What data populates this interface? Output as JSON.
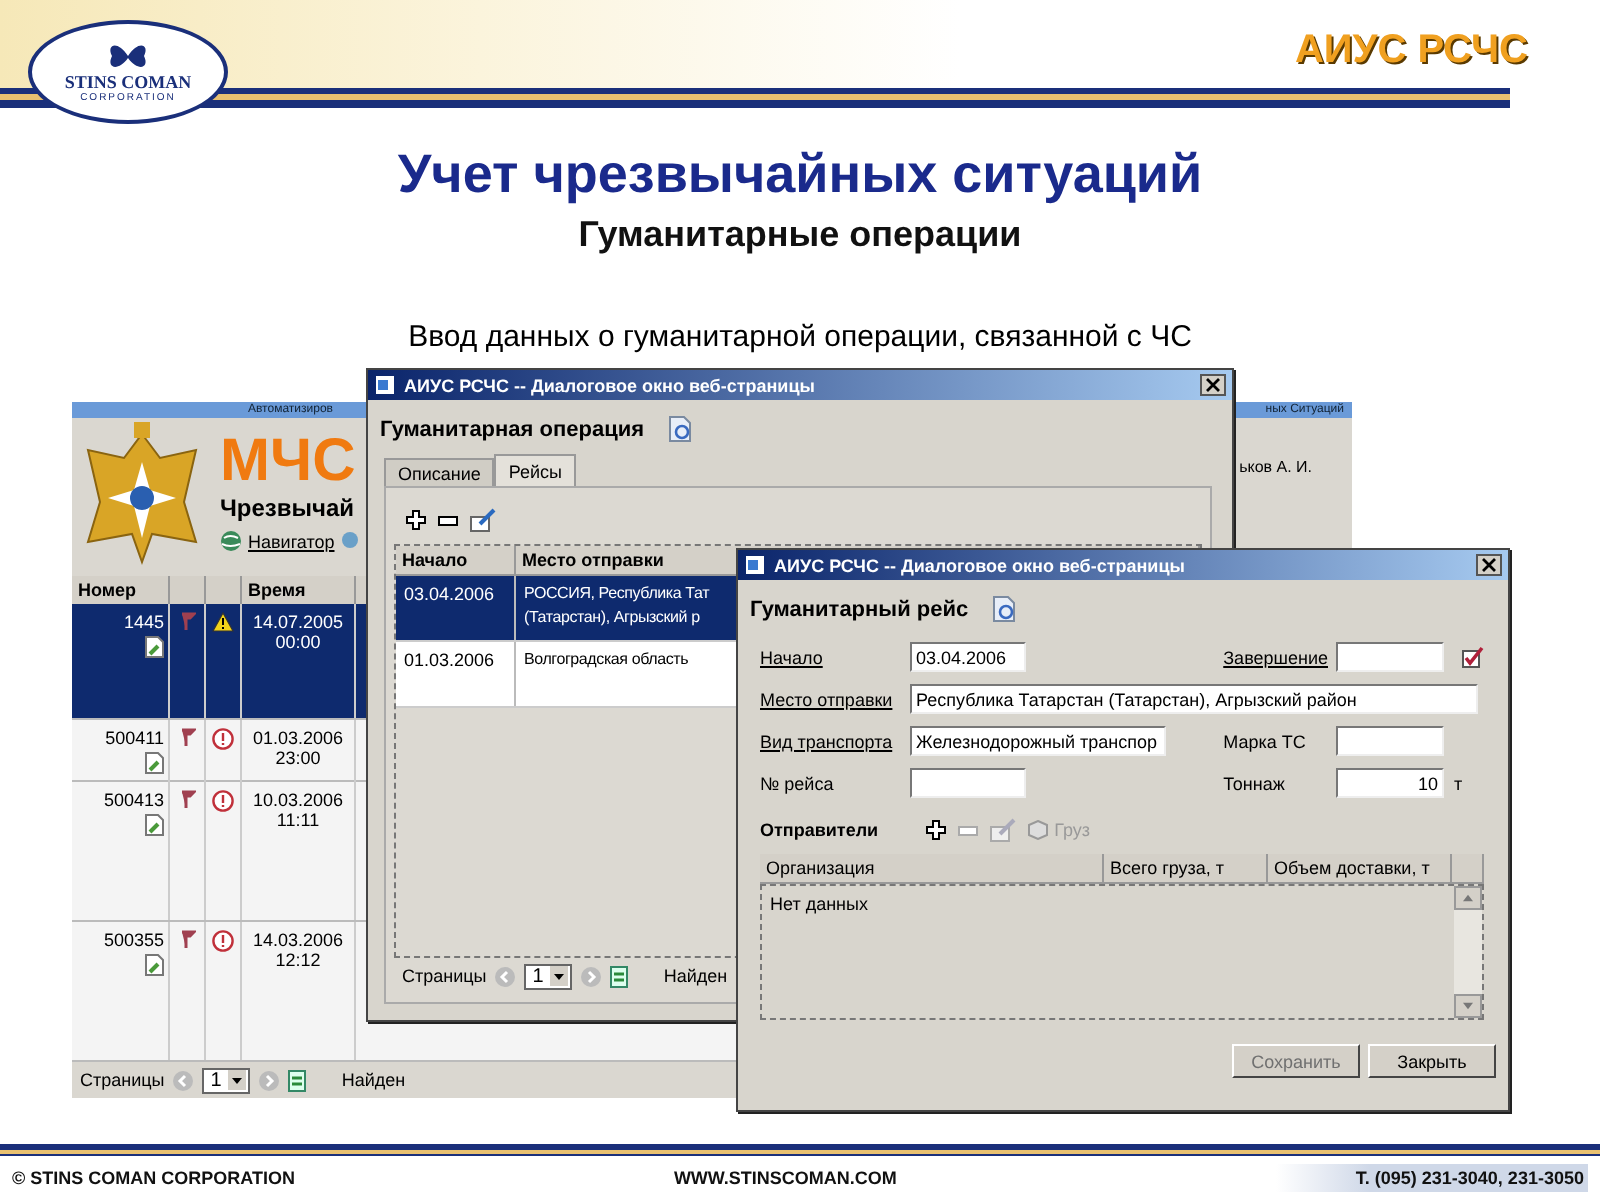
{
  "slide": {
    "brand": "АИУС РСЧС",
    "logo_name": "STINS COMAN",
    "logo_sub": "CORPORATION",
    "title": "Учет чрезвычайных ситуаций",
    "subtitle": "Гуманитарные операции",
    "description": "Ввод данных о гуманитарной операции, связанной с ЧС"
  },
  "background_app": {
    "banner_left": "Автоматизиров",
    "banner_right": "ных Ситуаций",
    "logo_text": "МЧС",
    "heading": "Чрезвычай",
    "nav_link": "Навигатор",
    "user": "ьков А. И.",
    "columns": [
      "Номер",
      "Время"
    ],
    "rows": [
      {
        "number": "1445",
        "date": "14.07.2005",
        "time": "00:00",
        "kind": "warning",
        "selected": true
      },
      {
        "number": "500411",
        "date": "01.03.2006",
        "time": "23:00",
        "kind": "error",
        "selected": false
      },
      {
        "number": "500413",
        "date": "10.03.2006",
        "time": "11:11",
        "kind": "error",
        "selected": false
      },
      {
        "number": "500355",
        "date": "14.03.2006",
        "time": "12:12",
        "kind": "error",
        "selected": false
      }
    ],
    "pager": {
      "label": "Страницы",
      "page": "1",
      "found": "Найден"
    }
  },
  "operation_dialog": {
    "title": "АИУС РСЧС -- Диалоговое окно веб-страницы",
    "heading": "Гуманитарная операция",
    "tabs": [
      {
        "label": "Описание",
        "selected": false
      },
      {
        "label": "Рейсы",
        "selected": true
      }
    ],
    "columns": [
      "Начало",
      "Место отправки"
    ],
    "rows": [
      {
        "start": "03.04.2006",
        "place": [
          "РОССИЯ, Республика Тат",
          "(Татарстан), Агрызский р"
        ],
        "selected": true
      },
      {
        "start": "01.03.2006",
        "place": [
          "Волгоградская область"
        ],
        "selected": false
      }
    ],
    "pager": {
      "label": "Страницы",
      "page": "1",
      "found": "Найден"
    }
  },
  "flight_dialog": {
    "title": "АИУС РСЧС -- Диалоговое окно веб-страницы",
    "heading": "Гуманитарный рейс",
    "fields": [
      {
        "label": "Начало",
        "value": "03.04.2006",
        "link": true
      },
      {
        "label": "Завершение",
        "link": true
      },
      {
        "label": "Место отправки",
        "value": "Республика Татарстан (Татарстан), Агрызский район",
        "link": true
      },
      {
        "label": "Вид транспорта",
        "value": "Железнодорожный транспор",
        "link": true
      },
      {
        "label": "Марка ТС",
        "link": false
      },
      {
        "label": "№ рейса",
        "link": false
      },
      {
        "label": "Тоннаж",
        "value": "10",
        "unit": "т",
        "link": false
      }
    ],
    "senders_label": "Отправители",
    "cargo_button": {
      "label": "Груз",
      "disabled": true
    },
    "columns": [
      "Организация",
      "Всего груза, т",
      "Объем доставки, т"
    ],
    "empty_text": "Нет данных",
    "buttons": [
      {
        "label": "Сохранить",
        "disabled": true
      },
      {
        "label": "Закрыть",
        "disabled": false
      }
    ]
  },
  "footer": {
    "left": "© STINS COMAN CORPORATION",
    "center": "WWW.STINSCOMAN.COM",
    "right": "Т. (095) 231-3040, 231-3050"
  }
}
